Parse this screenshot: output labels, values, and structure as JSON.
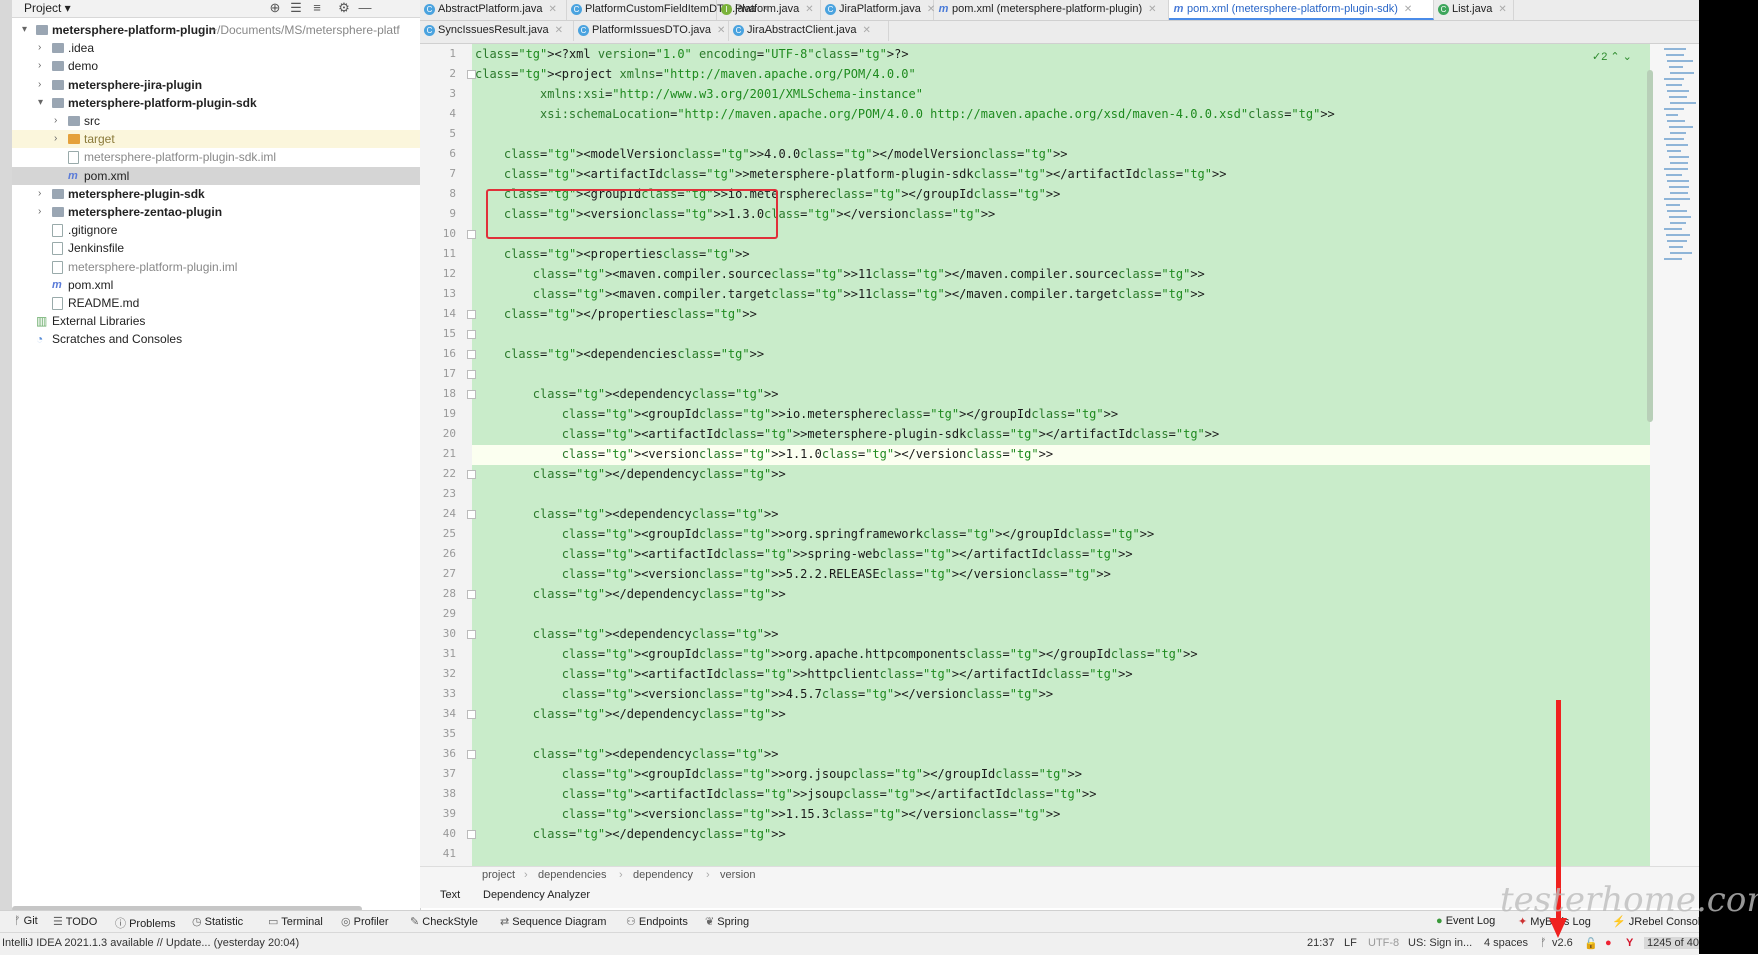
{
  "project_panel": {
    "title": "Project ▾",
    "header_icons": [
      "locate-icon",
      "expand-all-icon",
      "collapse-all-icon",
      "gear-icon",
      "minimize-icon"
    ],
    "items": [
      {
        "label": "metersphere-platform-plugin",
        "suffix": "~/Documents/MS/metersphere-platf",
        "indent": 0,
        "arrow": "▾",
        "icon": "folder",
        "bold": true
      },
      {
        "label": ".idea",
        "indent": 1,
        "arrow": "›",
        "icon": "folder"
      },
      {
        "label": "demo",
        "indent": 1,
        "arrow": "›",
        "icon": "folder"
      },
      {
        "label": "metersphere-jira-plugin",
        "indent": 1,
        "arrow": "›",
        "icon": "folder",
        "bold": true
      },
      {
        "label": "metersphere-platform-plugin-sdk",
        "indent": 1,
        "arrow": "▾",
        "icon": "folder",
        "bold": true
      },
      {
        "label": "src",
        "indent": 2,
        "arrow": "›",
        "icon": "folder"
      },
      {
        "label": "target",
        "indent": 2,
        "arrow": "›",
        "icon": "folder-orange",
        "highlight": true
      },
      {
        "label": "metersphere-platform-plugin-sdk.iml",
        "indent": 2,
        "icon": "file",
        "grey": true
      },
      {
        "label": "pom.xml",
        "indent": 2,
        "icon": "mxml",
        "selected": true
      },
      {
        "label": "metersphere-plugin-sdk",
        "indent": 1,
        "arrow": "›",
        "icon": "folder",
        "bold": true
      },
      {
        "label": "metersphere-zentao-plugin",
        "indent": 1,
        "arrow": "›",
        "icon": "folder",
        "bold": true
      },
      {
        "label": ".gitignore",
        "indent": 1,
        "icon": "file"
      },
      {
        "label": "Jenkinsfile",
        "indent": 1,
        "icon": "file"
      },
      {
        "label": "metersphere-platform-plugin.iml",
        "indent": 1,
        "icon": "file",
        "grey": true
      },
      {
        "label": "pom.xml",
        "indent": 1,
        "icon": "mxml"
      },
      {
        "label": "README.md",
        "indent": 1,
        "icon": "file"
      },
      {
        "label": "External Libraries",
        "indent": 0,
        "icon": "lib"
      },
      {
        "label": "Scratches and Consoles",
        "indent": 0,
        "icon": "scratch"
      }
    ]
  },
  "tabs_row1": [
    {
      "label": "AbstractPlatform.java",
      "icon": "c"
    },
    {
      "label": "PlatformCustomFieldItemDTO.java",
      "icon": "c"
    },
    {
      "label": "Platform.java",
      "icon": "i"
    },
    {
      "label": "JiraPlatform.java",
      "icon": "c"
    },
    {
      "label": "pom.xml (metersphere-platform-plugin)",
      "icon": "m"
    },
    {
      "label": "pom.xml (metersphere-platform-plugin-sdk)",
      "icon": "m",
      "active": true
    },
    {
      "label": "List.java",
      "icon": "l"
    }
  ],
  "tabs_row2": [
    {
      "label": "SyncIssuesResult.java",
      "icon": "c"
    },
    {
      "label": "PlatformIssuesDTO.java",
      "icon": "c"
    },
    {
      "label": "JiraAbstractClient.java",
      "icon": "c"
    }
  ],
  "inspection": "✓2 ⌃ ⌄",
  "code_lines": [
    "<?xml version=\"1.0\" encoding=\"UTF-8\"?>",
    "<project xmlns=\"http://maven.apache.org/POM/4.0.0\"",
    "         xmlns:xsi=\"http://www.w3.org/2001/XMLSchema-instance\"",
    "         xsi:schemaLocation=\"http://maven.apache.org/POM/4.0.0 http://maven.apache.org/xsd/maven-4.0.0.xsd\">",
    "",
    "    <modelVersion>4.0.0</modelVersion>",
    "    <artifactId>metersphere-platform-plugin-sdk</artifactId>",
    "    <groupId>io.metersphere</groupId>",
    "    <version>1.3.0</version>",
    "",
    "    <properties>",
    "        <maven.compiler.source>11</maven.compiler.source>",
    "        <maven.compiler.target>11</maven.compiler.target>",
    "    </properties>",
    "",
    "    <dependencies>",
    "",
    "        <dependency>",
    "            <groupId>io.metersphere</groupId>",
    "            <artifactId>metersphere-plugin-sdk</artifactId>",
    "            <version>1.1.0</version>",
    "        </dependency>",
    "",
    "        <dependency>",
    "            <groupId>org.springframework</groupId>",
    "            <artifactId>spring-web</artifactId>",
    "            <version>5.2.2.RELEASE</version>",
    "        </dependency>",
    "",
    "        <dependency>",
    "            <groupId>org.apache.httpcomponents</groupId>",
    "            <artifactId>httpclient</artifactId>",
    "            <version>4.5.7</version>",
    "        </dependency>",
    "",
    "        <dependency>",
    "            <groupId>org.jsoup</groupId>",
    "            <artifactId>jsoup</artifactId>",
    "            <version>1.15.3</version>",
    "        </dependency>",
    ""
  ],
  "line_numbers": [
    "1",
    "2",
    "3",
    "4",
    "5",
    "6",
    "7",
    "8",
    "9",
    "10",
    "11",
    "12",
    "13",
    "14",
    "15",
    "16",
    "17",
    "18",
    "19",
    "20",
    "21",
    "22",
    "23",
    "24",
    "25",
    "26",
    "27",
    "28",
    "29",
    "30",
    "31",
    "32",
    "33",
    "34",
    "35",
    "36",
    "37",
    "38",
    "39",
    "40",
    "41"
  ],
  "current_line": 21,
  "breadcrumb": [
    "project",
    "dependencies",
    "dependency",
    "version"
  ],
  "subtabs": [
    "Text",
    "Dependency Analyzer"
  ],
  "tool_windows_left": [
    {
      "label": "Git",
      "icon": "git-icon"
    },
    {
      "label": "TODO",
      "icon": "list-icon"
    },
    {
      "label": "Problems",
      "icon": "info-icon"
    },
    {
      "label": "Statistic",
      "icon": "clock-icon"
    },
    {
      "label": "Terminal",
      "icon": "terminal-icon"
    },
    {
      "label": "Profiler",
      "icon": "profiler-icon"
    },
    {
      "label": "CheckStyle",
      "icon": "checkstyle-icon"
    },
    {
      "label": "Sequence Diagram",
      "icon": "sequence-icon"
    },
    {
      "label": "Endpoints",
      "icon": "endpoints-icon"
    },
    {
      "label": "Spring",
      "icon": "spring-icon"
    }
  ],
  "tool_windows_right": [
    {
      "label": "Event Log",
      "icon": "event-log-icon"
    },
    {
      "label": "MyBatis Log",
      "icon": "mybatis-icon"
    },
    {
      "label": "JRebel Console",
      "icon": "jrebel-icon"
    }
  ],
  "status": {
    "message": "IntelliJ IDEA 2021.1.3 available // Update... (yesterday 20:04)",
    "position": "21:37",
    "line_sep": "LF",
    "encoding": "UTF-8",
    "us": "US: Sign in...",
    "indent": "4 spaces",
    "branch": "v2.6",
    "memory": "1245 of 40"
  },
  "watermark": "testerhome.com",
  "colors": {
    "editor_bg": "#c9ecca",
    "tag": "#1d4fa8",
    "highlight_box": "#e0303a",
    "arrow": "#f0211f"
  }
}
